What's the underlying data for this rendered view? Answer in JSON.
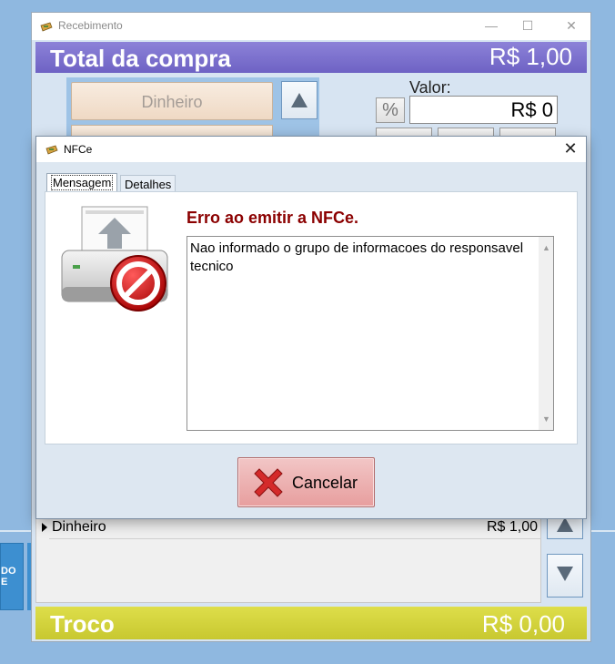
{
  "main_window": {
    "title": "Recebimento",
    "total_label": "Total da compra",
    "total_value": "R$ 1,00",
    "payment_button": "Dinheiro",
    "valor_label": "Valor:",
    "percent_button": "%",
    "valor_input": "R$ 0",
    "grid": {
      "rows": [
        {
          "name": "Dinheiro",
          "value": "R$ 1,00"
        }
      ]
    },
    "troco_label": "Troco",
    "troco_value": "R$ 0,00"
  },
  "side_tile": {
    "text": "DO\nE"
  },
  "dialog": {
    "title": "NFCe",
    "tabs": [
      {
        "label": "Mensagem",
        "active": true
      },
      {
        "label": "Detalhes",
        "active": false
      }
    ],
    "error_title": "Erro ao emitir a NFCe.",
    "message": "Nao informado o grupo de informacoes do responsavel tecnico",
    "cancel_label": "Cancelar"
  },
  "icons": [
    "app-icon",
    "minimize-icon",
    "maximize-icon",
    "close-icon",
    "arrow-up-icon",
    "arrow-down-icon",
    "printer-error-icon",
    "cancel-x-icon"
  ],
  "colors": {
    "total_bar": "#7a6fcc",
    "troco_bar": "#d4d43a",
    "error_text": "#8b0000",
    "cancel_button": "#ebb0b0",
    "desktop": "#8fb8e0"
  }
}
